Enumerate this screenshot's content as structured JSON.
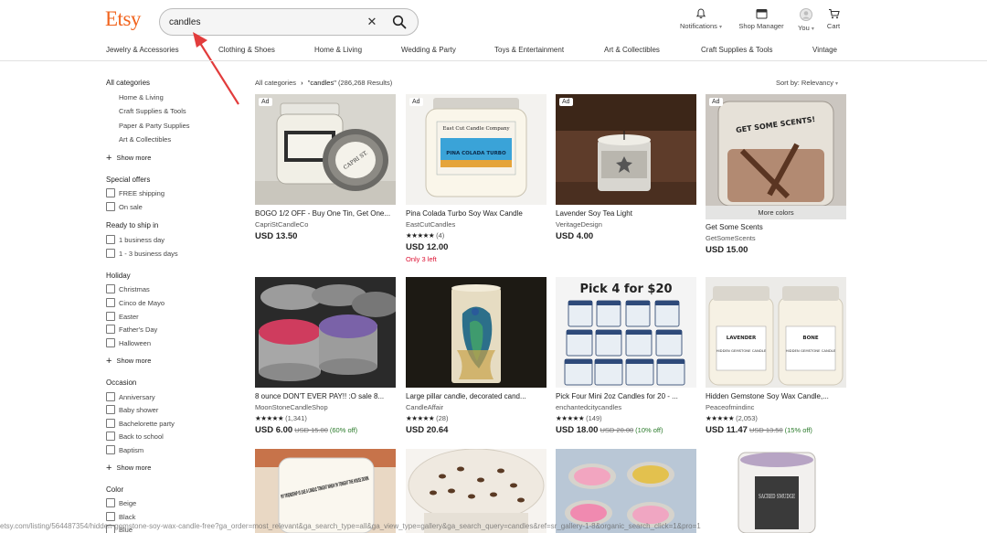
{
  "header": {
    "logo": "Etsy",
    "search_value": "candles",
    "notifications_label": "Notifications",
    "shop_manager_label": "Shop Manager",
    "you_label": "You",
    "cart_label": "Cart"
  },
  "categories_nav": [
    "Jewelry & Accessories",
    "Clothing & Shoes",
    "Home & Living",
    "Wedding & Party",
    "Toys & Entertainment",
    "Art & Collectibles",
    "Craft Supplies & Tools",
    "Vintage"
  ],
  "sidebar": {
    "all_categories": "All categories",
    "sub_categories": [
      "Home & Living",
      "Craft Supplies & Tools",
      "Paper & Party Supplies",
      "Art & Collectibles"
    ],
    "show_more": "Show more",
    "special_offers": {
      "heading": "Special offers",
      "options": [
        "FREE shipping",
        "On sale"
      ]
    },
    "ready_to_ship": {
      "heading": "Ready to ship in",
      "options": [
        "1 business day",
        "1 - 3 business days"
      ]
    },
    "holiday": {
      "heading": "Holiday",
      "options": [
        "Christmas",
        "Cinco de Mayo",
        "Easter",
        "Father's Day",
        "Halloween"
      ]
    },
    "occasion": {
      "heading": "Occasion",
      "options": [
        "Anniversary",
        "Baby shower",
        "Bachelorette party",
        "Back to school",
        "Baptism"
      ]
    },
    "color": {
      "heading": "Color",
      "options": [
        "Beige",
        "Black",
        "Blue"
      ]
    }
  },
  "results": {
    "breadcrumb_root": "All categories",
    "breadcrumb_query": "\"candles\"",
    "result_count": "(286,268 Results)",
    "sort_label": "Sort by: Relevancy"
  },
  "listings": [
    {
      "title": "BOGO 1/2 OFF - Buy One Tin, Get One...",
      "shop": "CapriStCandleCo",
      "price": "USD 13.50",
      "ad": "Ad",
      "stars": "",
      "reviews": "",
      "old_price": "",
      "discount": "",
      "stock_note": "",
      "more_colors": ""
    },
    {
      "title": "Pina Colada Turbo Soy Wax Candle",
      "shop": "EastCutCandles",
      "price": "USD 12.00",
      "ad": "Ad",
      "stars": "★★★★★",
      "reviews": "(4)",
      "old_price": "",
      "discount": "",
      "stock_note": "Only 3 left",
      "more_colors": ""
    },
    {
      "title": "Lavender Soy Tea Light",
      "shop": "VeritageDesign",
      "price": "USD 4.00",
      "ad": "Ad",
      "stars": "",
      "reviews": "",
      "old_price": "",
      "discount": "",
      "stock_note": "",
      "more_colors": ""
    },
    {
      "title": "Get Some Scents",
      "shop": "GetSomeScents",
      "price": "USD 15.00",
      "ad": "Ad",
      "stars": "",
      "reviews": "",
      "old_price": "",
      "discount": "",
      "stock_note": "",
      "more_colors": "More colors"
    },
    {
      "title": "8 ounce DON'T EVER PAY!! :O sale 8...",
      "shop": "MoonStoneCandleShop",
      "price": "USD 6.00",
      "ad": "",
      "stars": "★★★★★",
      "reviews": "(1,341)",
      "old_price": "USD 15.00",
      "discount": "(60% off)",
      "stock_note": "",
      "more_colors": ""
    },
    {
      "title": "Large pillar candle, decorated cand...",
      "shop": "CandleAffair",
      "price": "USD 20.64",
      "ad": "",
      "stars": "★★★★★",
      "reviews": "(28)",
      "old_price": "",
      "discount": "",
      "stock_note": "",
      "more_colors": ""
    },
    {
      "title": "Pick Four Mini 2oz Candles for 20 - ...",
      "shop": "enchantedcitycandles",
      "price": "USD 18.00",
      "ad": "",
      "stars": "★★★★★",
      "reviews": "(149)",
      "old_price": "USD 20.00",
      "discount": "(10% off)",
      "stock_note": "",
      "more_colors": ""
    },
    {
      "title": "Hidden Gemstone Soy Wax Candle,...",
      "shop": "Peaceofmindinc",
      "price": "USD 11.47",
      "ad": "",
      "stars": "★★★★★",
      "reviews": "(2,053)",
      "old_price": "USD 13.50",
      "discount": "(15% off)",
      "stock_note": "",
      "more_colors": ""
    }
  ],
  "image_text": {
    "pick4": "Pick 4 for $20",
    "get_some_scents": "GET SOME SCENTS!",
    "capri": "CAPRI ST.",
    "eastcut_brand": "East Cut Candle Company",
    "eastcut_name": "PINA COLADA TURBO",
    "lavender_label": "LAVENDER",
    "bone_label": "BONE",
    "hidden_gem": "HIDDEN GEMSTONE CANDLE",
    "friendship": "MY FRIENDSHIP IS LIKE A CANDLE TONIGHT WHEN I'M TONIGHT THE HOUSE DOWN",
    "sacred": "SACRED SMUDGE"
  },
  "status_url": "etsy.com/listing/564487354/hidden-gemstone-soy-wax-candle-free?ga_order=most_relevant&ga_search_type=all&ga_view_type=gallery&ga_search_query=candles&ref=sr_gallery-1-8&organic_search_click=1&pro=1"
}
